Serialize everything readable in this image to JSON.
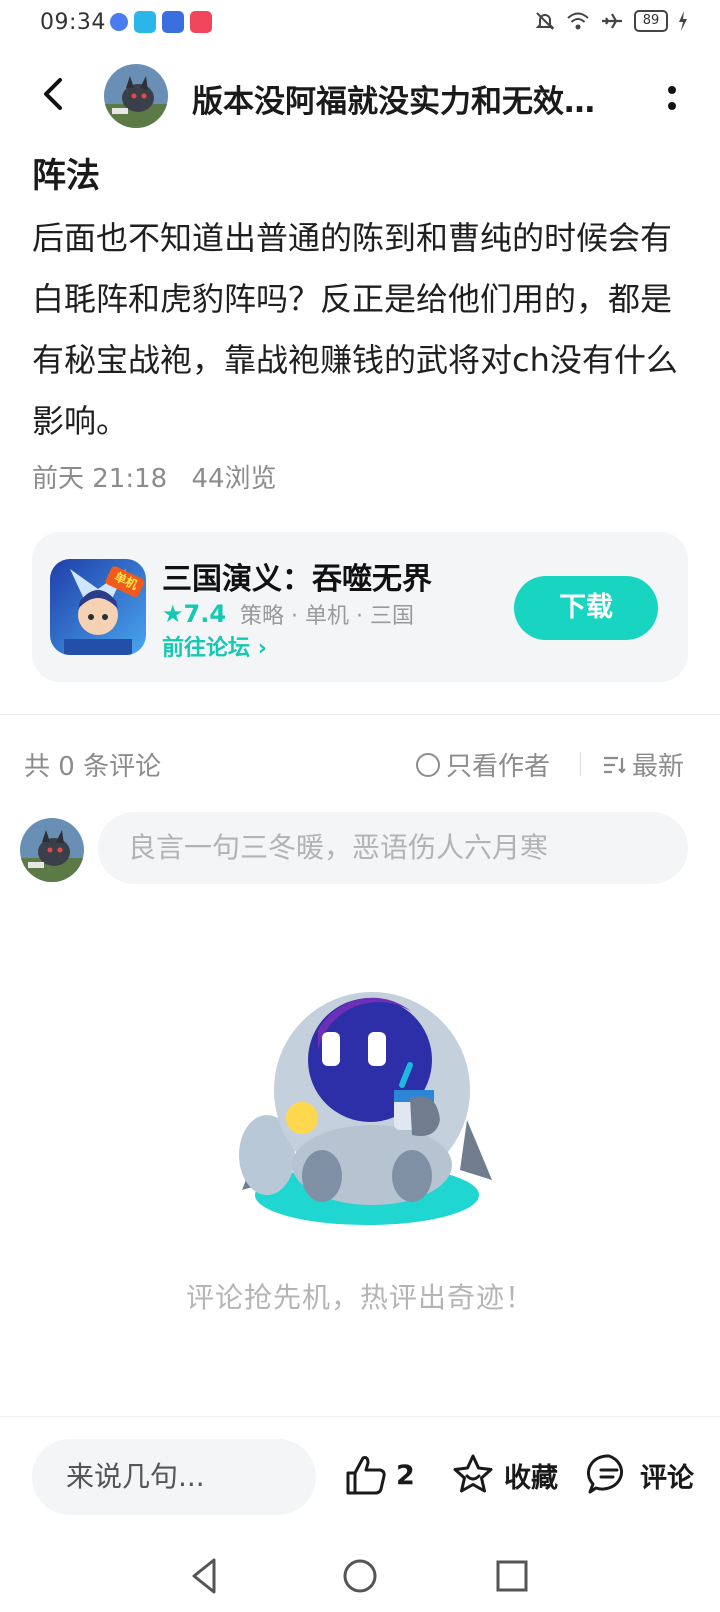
{
  "status_bar": {
    "time": "09:34",
    "battery": "89"
  },
  "header": {
    "title": "版本没阿福就没实力和无效阵法"
  },
  "post": {
    "title": "阵法",
    "body": "后面也不知道出普通的陈到和曹纯的时候会有白毦阵和虎豹阵吗？反正是给他们用的，都是有秘宝战袍，靠战袍赚钱的武将对ch没有什么影响。",
    "date": "前天 21:18",
    "views": "44浏览"
  },
  "game_card": {
    "name": "三国演义：吞噬无界",
    "rating": "7.4",
    "tags": "策略 · 单机 · 三国",
    "forum_link": "前往论坛",
    "download_label": "下载",
    "icon_badge": "单机"
  },
  "comments": {
    "count_label": "共 0 条评论",
    "author_only_label": "只看作者",
    "sort_label": "最新",
    "input_placeholder": "良言一句三冬暖，恶语伤人六月寒",
    "empty_text": "评论抢先机，热评出奇迹！"
  },
  "bottom_bar": {
    "reply_placeholder": "来说几句...",
    "like_count": "2",
    "favorite_label": "收藏",
    "comment_label": "评论"
  },
  "colors": {
    "accent": "#17d5c1",
    "rating": "#13c9b2"
  }
}
